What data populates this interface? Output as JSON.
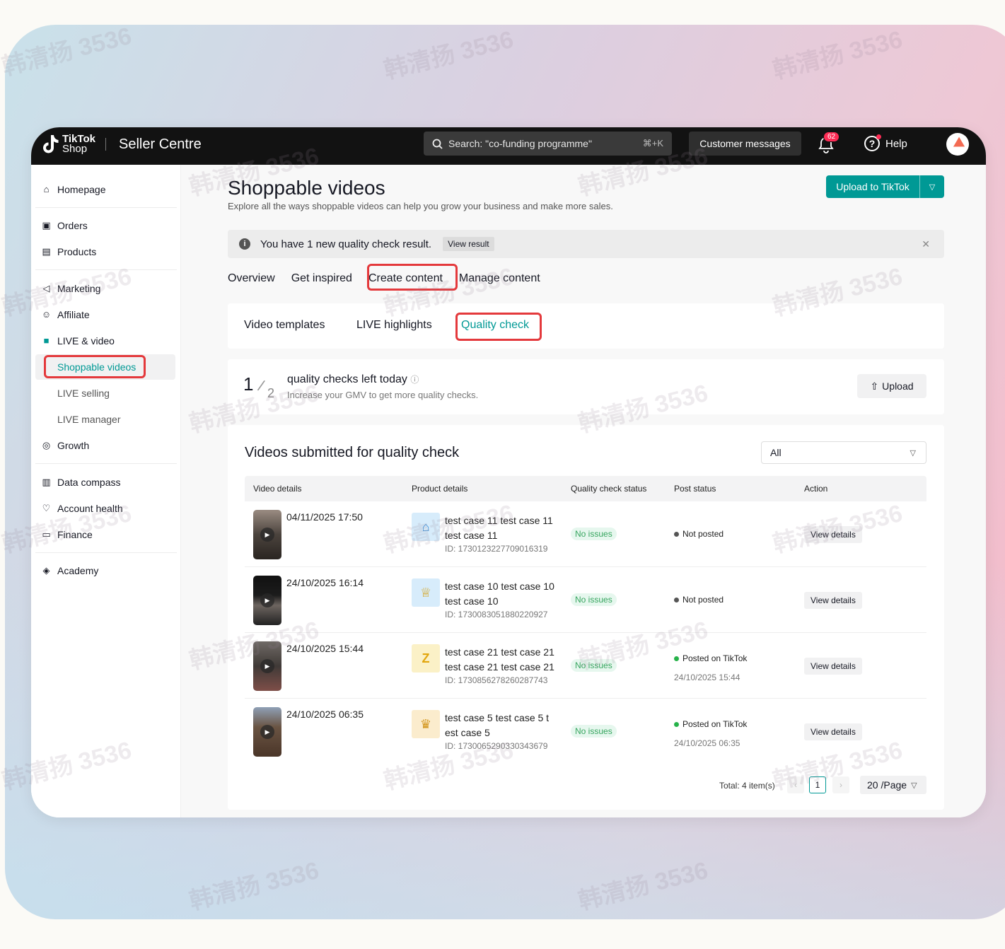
{
  "colors": {
    "accent": "#009995",
    "topbar": "#121212",
    "highlight_box": "#e4393c",
    "badge": "#fe2c55"
  },
  "watermark_text": "韩清扬 3536",
  "topbar": {
    "logo_line1": "TikTok",
    "logo_line2": "Shop",
    "app_title": "Seller Centre",
    "search_placeholder": "Search: \"co-funding programme\"",
    "search_shortcut": "⌘+K",
    "customer_messages": "Customer messages",
    "notification_count": "62",
    "help_label": "Help"
  },
  "sidebar": {
    "homepage": "Homepage",
    "orders": "Orders",
    "products": "Products",
    "marketing": "Marketing",
    "affiliate": "Affiliate",
    "live_video": "LIVE & video",
    "shoppable_videos": "Shoppable videos",
    "live_selling": "LIVE selling",
    "live_manager": "LIVE manager",
    "growth": "Growth",
    "data_compass": "Data compass",
    "account_health": "Account health",
    "finance": "Finance",
    "academy": "Academy"
  },
  "main": {
    "title": "Shoppable videos",
    "subtitle": "Explore all the ways shoppable videos can help you grow your business and make more sales.",
    "upload_button": "Upload to TikTok",
    "notice_text": "You have 1 new quality check result.",
    "notice_action": "View result",
    "tabs": [
      "Overview",
      "Get inspired",
      "Create content",
      "Manage content"
    ],
    "subtabs": [
      "Video templates",
      "LIVE highlights",
      "Quality check"
    ]
  },
  "quota": {
    "used": "1",
    "total": "2",
    "title": "quality checks left today",
    "subtitle": "Increase your GMV to get more quality checks.",
    "upload": "Upload"
  },
  "table": {
    "title": "Videos submitted for quality check",
    "filter_value": "All",
    "headers": [
      "Video details",
      "Product details",
      "Quality check status",
      "Post status",
      "Action"
    ],
    "rows": [
      {
        "date": "04/11/2025 17:50",
        "product": "test case 11 test case 11 test case 11",
        "id": "ID: 1730123227709016319",
        "status": "No issues",
        "post": "Not posted",
        "post_date": "",
        "action": "View details",
        "icon": "house-icon"
      },
      {
        "date": "24/10/2025 16:14",
        "product": "test case 10 test case 10 test case 10",
        "id": "ID: 1730083051880220927",
        "status": "No issues",
        "post": "Not posted",
        "post_date": "",
        "action": "View details",
        "icon": "medal-icon"
      },
      {
        "date": "24/10/2025 15:44",
        "product": "test case 21 test case 21 test case 21 test case 21",
        "id": "ID: 1730856278260287743",
        "status": "No issues",
        "post": "Posted on TikTok",
        "post_date": "24/10/2025 15:44",
        "action": "View details",
        "icon": "z-letter-icon"
      },
      {
        "date": "24/10/2025 06:35",
        "product": "test case 5 test case 5 t est case 5",
        "id": "ID: 1730065290330343679",
        "status": "No issues",
        "post": "Posted on TikTok",
        "post_date": "24/10/2025 06:35",
        "action": "View details",
        "icon": "trophy-icon"
      }
    ],
    "pagination": {
      "total": "Total: 4 item(s)",
      "current_page": "1",
      "page_size": "20 /Page"
    }
  }
}
